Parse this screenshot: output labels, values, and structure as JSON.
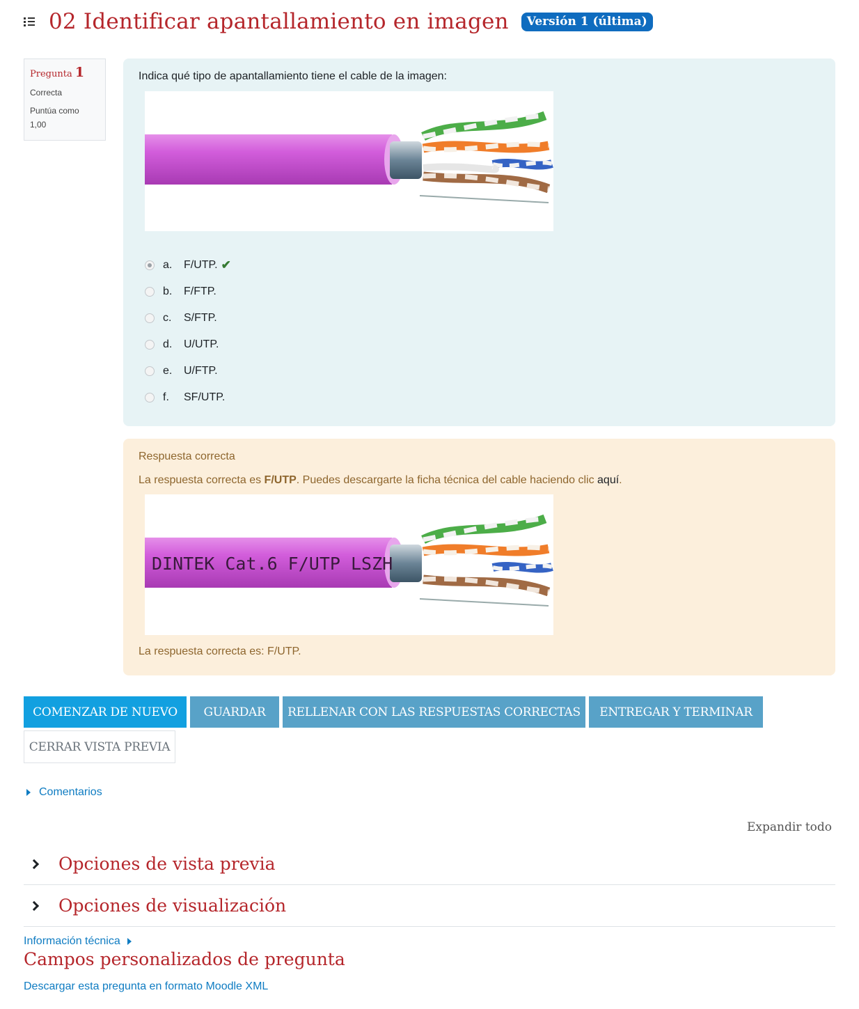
{
  "header": {
    "title": "02 Identificar apantallamiento en imagen",
    "version_badge": "Versión 1 (última)"
  },
  "question_info": {
    "label": "Pregunta",
    "number": "1",
    "state": "Correcta",
    "grade_label": "Puntúa como",
    "grade_value": "1,00"
  },
  "question": {
    "text": "Indica qué tipo de apantallamiento tiene el cable de la imagen:",
    "image_icon": "cable-photo",
    "answers": [
      {
        "letter": "a.",
        "text": "F/UTP.",
        "selected": true,
        "correct": true
      },
      {
        "letter": "b.",
        "text": "F/FTP.",
        "selected": false
      },
      {
        "letter": "c.",
        "text": "S/FTP.",
        "selected": false
      },
      {
        "letter": "d.",
        "text": "U/UTP.",
        "selected": false
      },
      {
        "letter": "e.",
        "text": "U/FTP.",
        "selected": false
      },
      {
        "letter": "f.",
        "text": "SF/UTP.",
        "selected": false
      }
    ]
  },
  "feedback": {
    "title": "Respuesta correcta",
    "text_before": "La respuesta correcta es ",
    "text_bold": "F/UTP",
    "text_after": ". Puedes descargarte la ficha técnica del cable haciendo clic ",
    "link": "aquí",
    "text_end": ".",
    "cable_print": "DINTEK Cat.6 F/UTP LSZH",
    "right_answer": "La respuesta correcta es: F/UTP."
  },
  "buttons": {
    "restart": "COMENZAR DE NUEVO",
    "save": "GUARDAR",
    "fill_correct": "RELLENAR CON LAS RESPUESTAS CORRECTAS",
    "submit": "ENTREGAR Y TERMINAR",
    "close_preview": "CERRAR VISTA PREVIA"
  },
  "comments": "Comentarios",
  "expand_all": "Expandir todo",
  "sections": {
    "preview_options": "Opciones de vista previa",
    "display_options": "Opciones de visualización"
  },
  "tech_info": "Información técnica",
  "custom_fields": "Campos personalizados de pregunta",
  "download_xml": "Descargar esta pregunta en formato Moodle XML",
  "colors": {
    "title_red": "#b5262b",
    "badge_blue": "#0f6cbf",
    "question_bg": "#e7f3f5",
    "feedback_bg": "#fcefdc",
    "cable_purple": "#d25ddb"
  }
}
